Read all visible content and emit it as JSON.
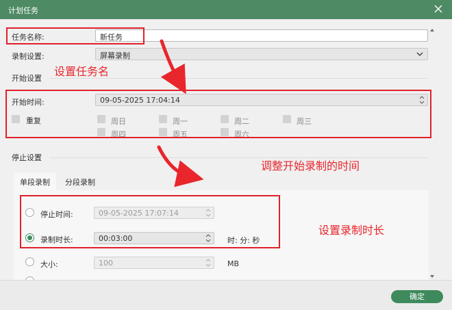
{
  "window": {
    "title": "计划任务"
  },
  "task_name": {
    "label": "任务名称:",
    "value": "新任务"
  },
  "record_setting": {
    "label": "录制设置:",
    "value": "屏幕录制"
  },
  "start_section": {
    "title": "开始设置",
    "start_time_label": "开始时间:",
    "start_time_value": "09-05-2025 17:04:14",
    "repeat_label": "重复",
    "days": [
      "周日",
      "周一",
      "周二",
      "周三",
      "周四",
      "周五",
      "周六"
    ]
  },
  "stop_section": {
    "title": "停止设置",
    "tabs": [
      "单段录制",
      "分段录制"
    ],
    "stop_time_label": "停止时间:",
    "stop_time_value": "09-05-2025 17:07:14",
    "duration_label": "录制时长:",
    "duration_value": "00:03:00",
    "duration_unit": "时: 分: 秒",
    "size_label": "大小:",
    "size_value": "100",
    "size_unit": "MB"
  },
  "annotations": {
    "set_name": "设置任务名",
    "adjust_time": "调整开始录制的时间",
    "set_duration": "设置录制时长"
  },
  "footer": {
    "ok_label": "确定"
  },
  "colors": {
    "titlebar": "#4e8a64",
    "accent": "#3e8a5c",
    "annotation": "#e8262c"
  }
}
